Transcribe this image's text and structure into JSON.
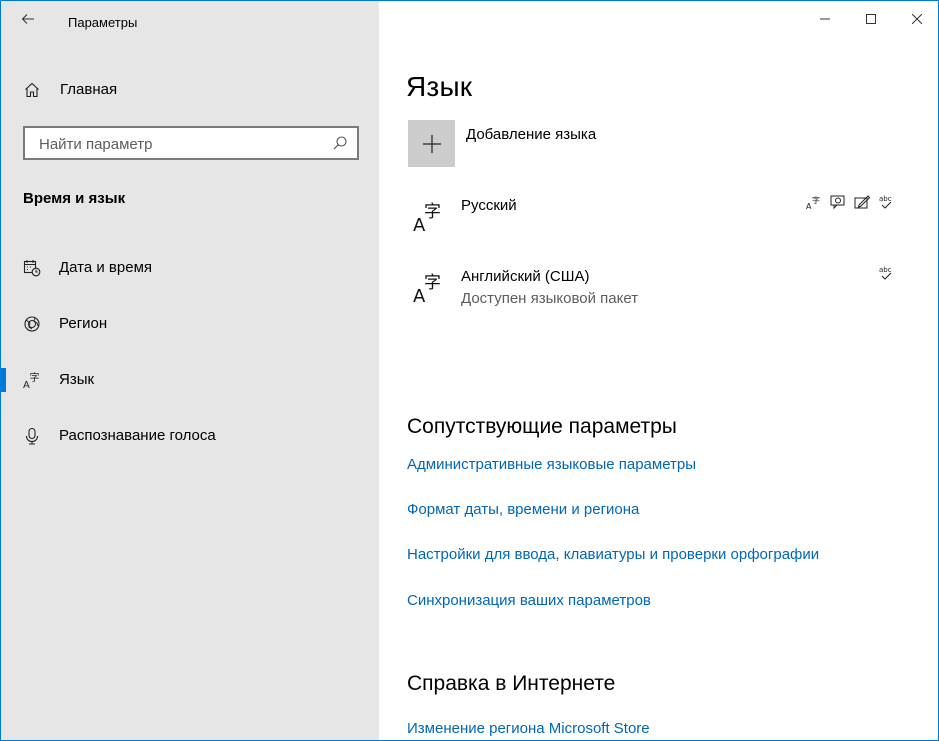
{
  "window": {
    "title": "Параметры",
    "accent_color": "#0078d7"
  },
  "sidebar": {
    "back_icon": "back-arrow-icon",
    "home_label": "Главная",
    "home_icon": "home-icon",
    "search_placeholder": "Найти параметр",
    "section_title": "Время и язык",
    "items": [
      {
        "label": "Дата и время",
        "icon": "calendar-clock-icon"
      },
      {
        "label": "Регион",
        "icon": "globe-icon"
      },
      {
        "label": "Язык",
        "icon": "language-icon",
        "active": true
      },
      {
        "label": "Распознавание голоса",
        "icon": "microphone-icon"
      }
    ]
  },
  "main": {
    "title": "Язык",
    "add_language_label": "Добавление языка",
    "languages": [
      {
        "name": "Русский",
        "sub": "",
        "features": [
          "display-language-icon",
          "speech-icon",
          "handwriting-icon",
          "spellcheck-icon"
        ]
      },
      {
        "name": "Английский (США)",
        "sub": "Доступен языковой пакет",
        "features": [
          "spellcheck-icon"
        ]
      }
    ],
    "related_title": "Сопутствующие параметры",
    "related_links": [
      "Административные языковые параметры",
      "Формат даты, времени и региона",
      "Настройки для ввода, клавиатуры и проверки орфографии",
      "Синхронизация ваших параметров"
    ],
    "help_title": "Справка в Интернете",
    "help_links": [
      "Изменение региона Microsoft Store"
    ],
    "link_color": "#0067b8"
  }
}
